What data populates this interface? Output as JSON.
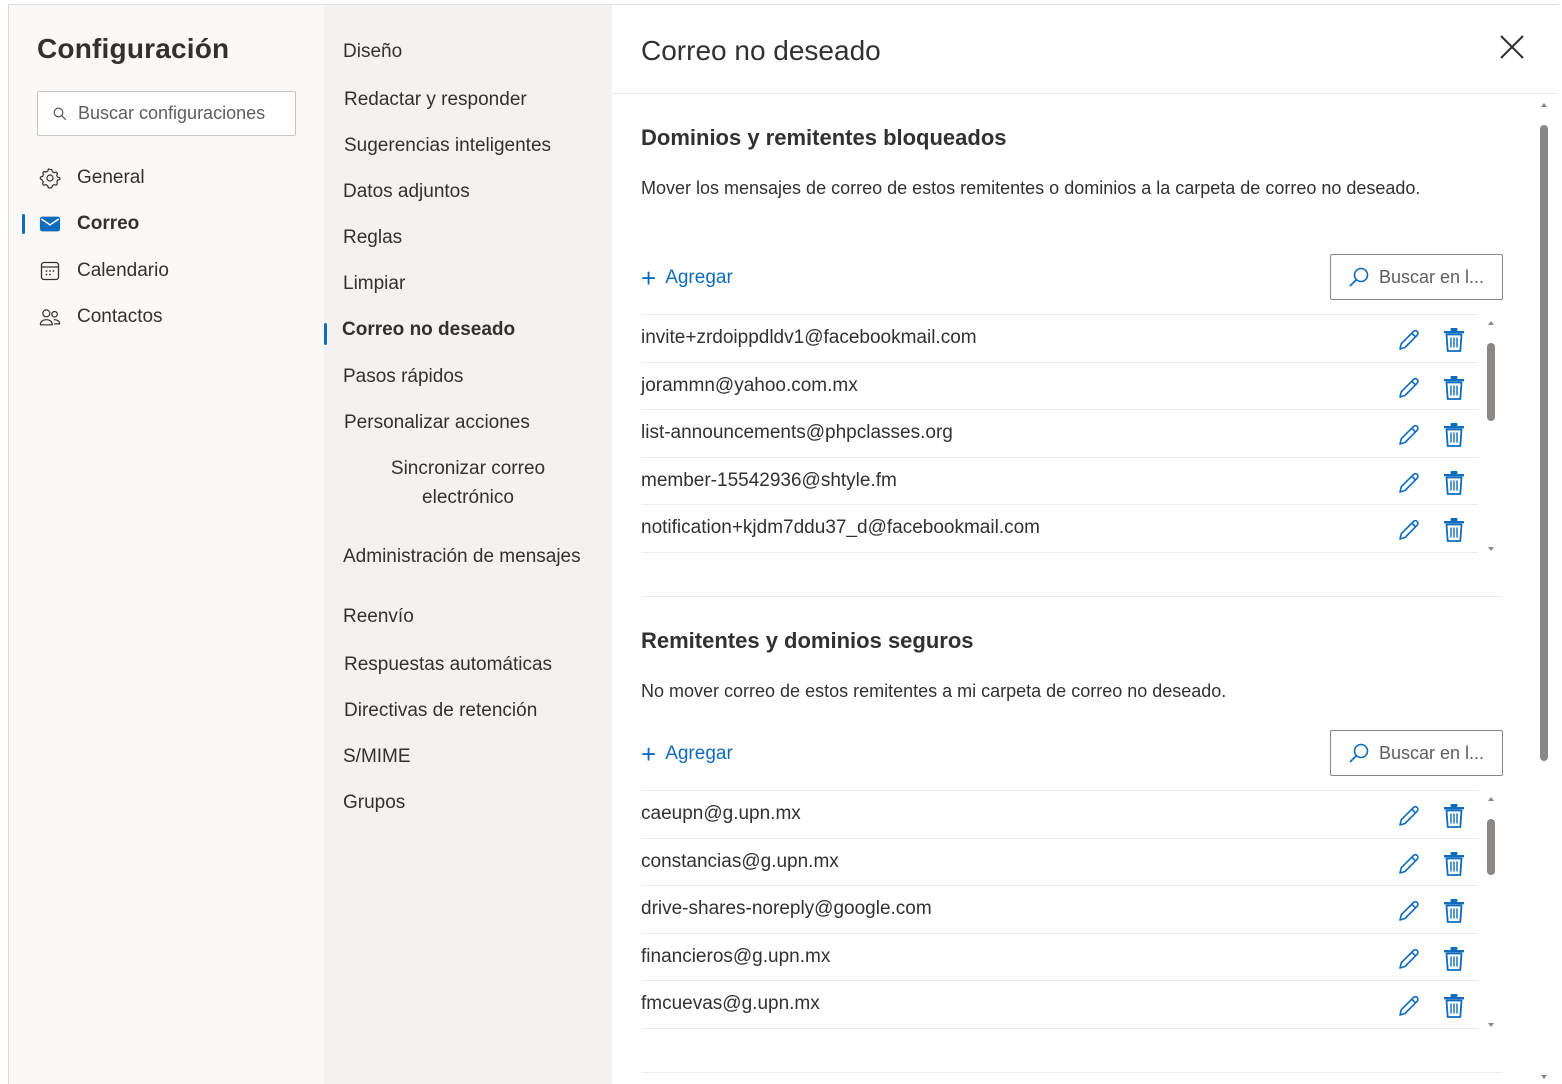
{
  "settings": {
    "title": "Configuración",
    "search_placeholder": "Buscar configuraciones"
  },
  "nav1": {
    "items": [
      {
        "label": "General",
        "icon": "gear-icon"
      },
      {
        "label": "Correo",
        "icon": "mail-icon",
        "active": true
      },
      {
        "label": "Calendario",
        "icon": "calendar-icon"
      },
      {
        "label": "Contactos",
        "icon": "people-icon"
      }
    ]
  },
  "nav2": {
    "items": [
      {
        "label": "Diseño"
      },
      {
        "label": "Redactar y responder"
      },
      {
        "label": "Sugerencias inteligentes"
      },
      {
        "label": "Datos adjuntos"
      },
      {
        "label": "Reglas"
      },
      {
        "label": "Limpiar"
      },
      {
        "label": "Correo no deseado",
        "active": true
      },
      {
        "label": "Pasos rápidos"
      },
      {
        "label": "Personalizar acciones"
      },
      {
        "label_line1": "Sincronizar correo",
        "label_line2": "electrónico"
      },
      {
        "label": "Administración de mensajes"
      },
      {
        "label": "Reenvío"
      },
      {
        "label": "Respuestas automáticas"
      },
      {
        "label": "Directivas de retención"
      },
      {
        "label": "S/MIME"
      },
      {
        "label": "Grupos"
      }
    ]
  },
  "main": {
    "title": "Correo no deseado",
    "blocked": {
      "title": "Dominios y remitentes bloqueados",
      "description": "Mover los mensajes de correo de estos remitentes o dominios a la carpeta de correo no deseado.",
      "add_label": "Agregar",
      "search_label": "Buscar en l...",
      "entries": [
        "invite+zrdoippdldv1@facebookmail.com",
        "jorammn@yahoo.com.mx",
        "list-announcements@phpclasses.org",
        "member-15542936@shtyle.fm",
        "notification+kjdm7ddu37_d@facebookmail.com"
      ]
    },
    "safe": {
      "title": "Remitentes y dominios seguros",
      "description": "No mover correo de estos remitentes a mi carpeta de correo no deseado.",
      "add_label": "Agregar",
      "search_label": "Buscar en l...",
      "entries": [
        "caeupn@g.upn.mx",
        "constancias@g.upn.mx",
        "drive-shares-noreply@google.com",
        "financieros@g.upn.mx",
        "fmcuevas@g.upn.mx"
      ]
    }
  },
  "colors": {
    "accent": "#0f6cbd",
    "nav_bg": "#faf9f8",
    "subnav_bg": "#f3f2f1",
    "text": "#323130"
  }
}
